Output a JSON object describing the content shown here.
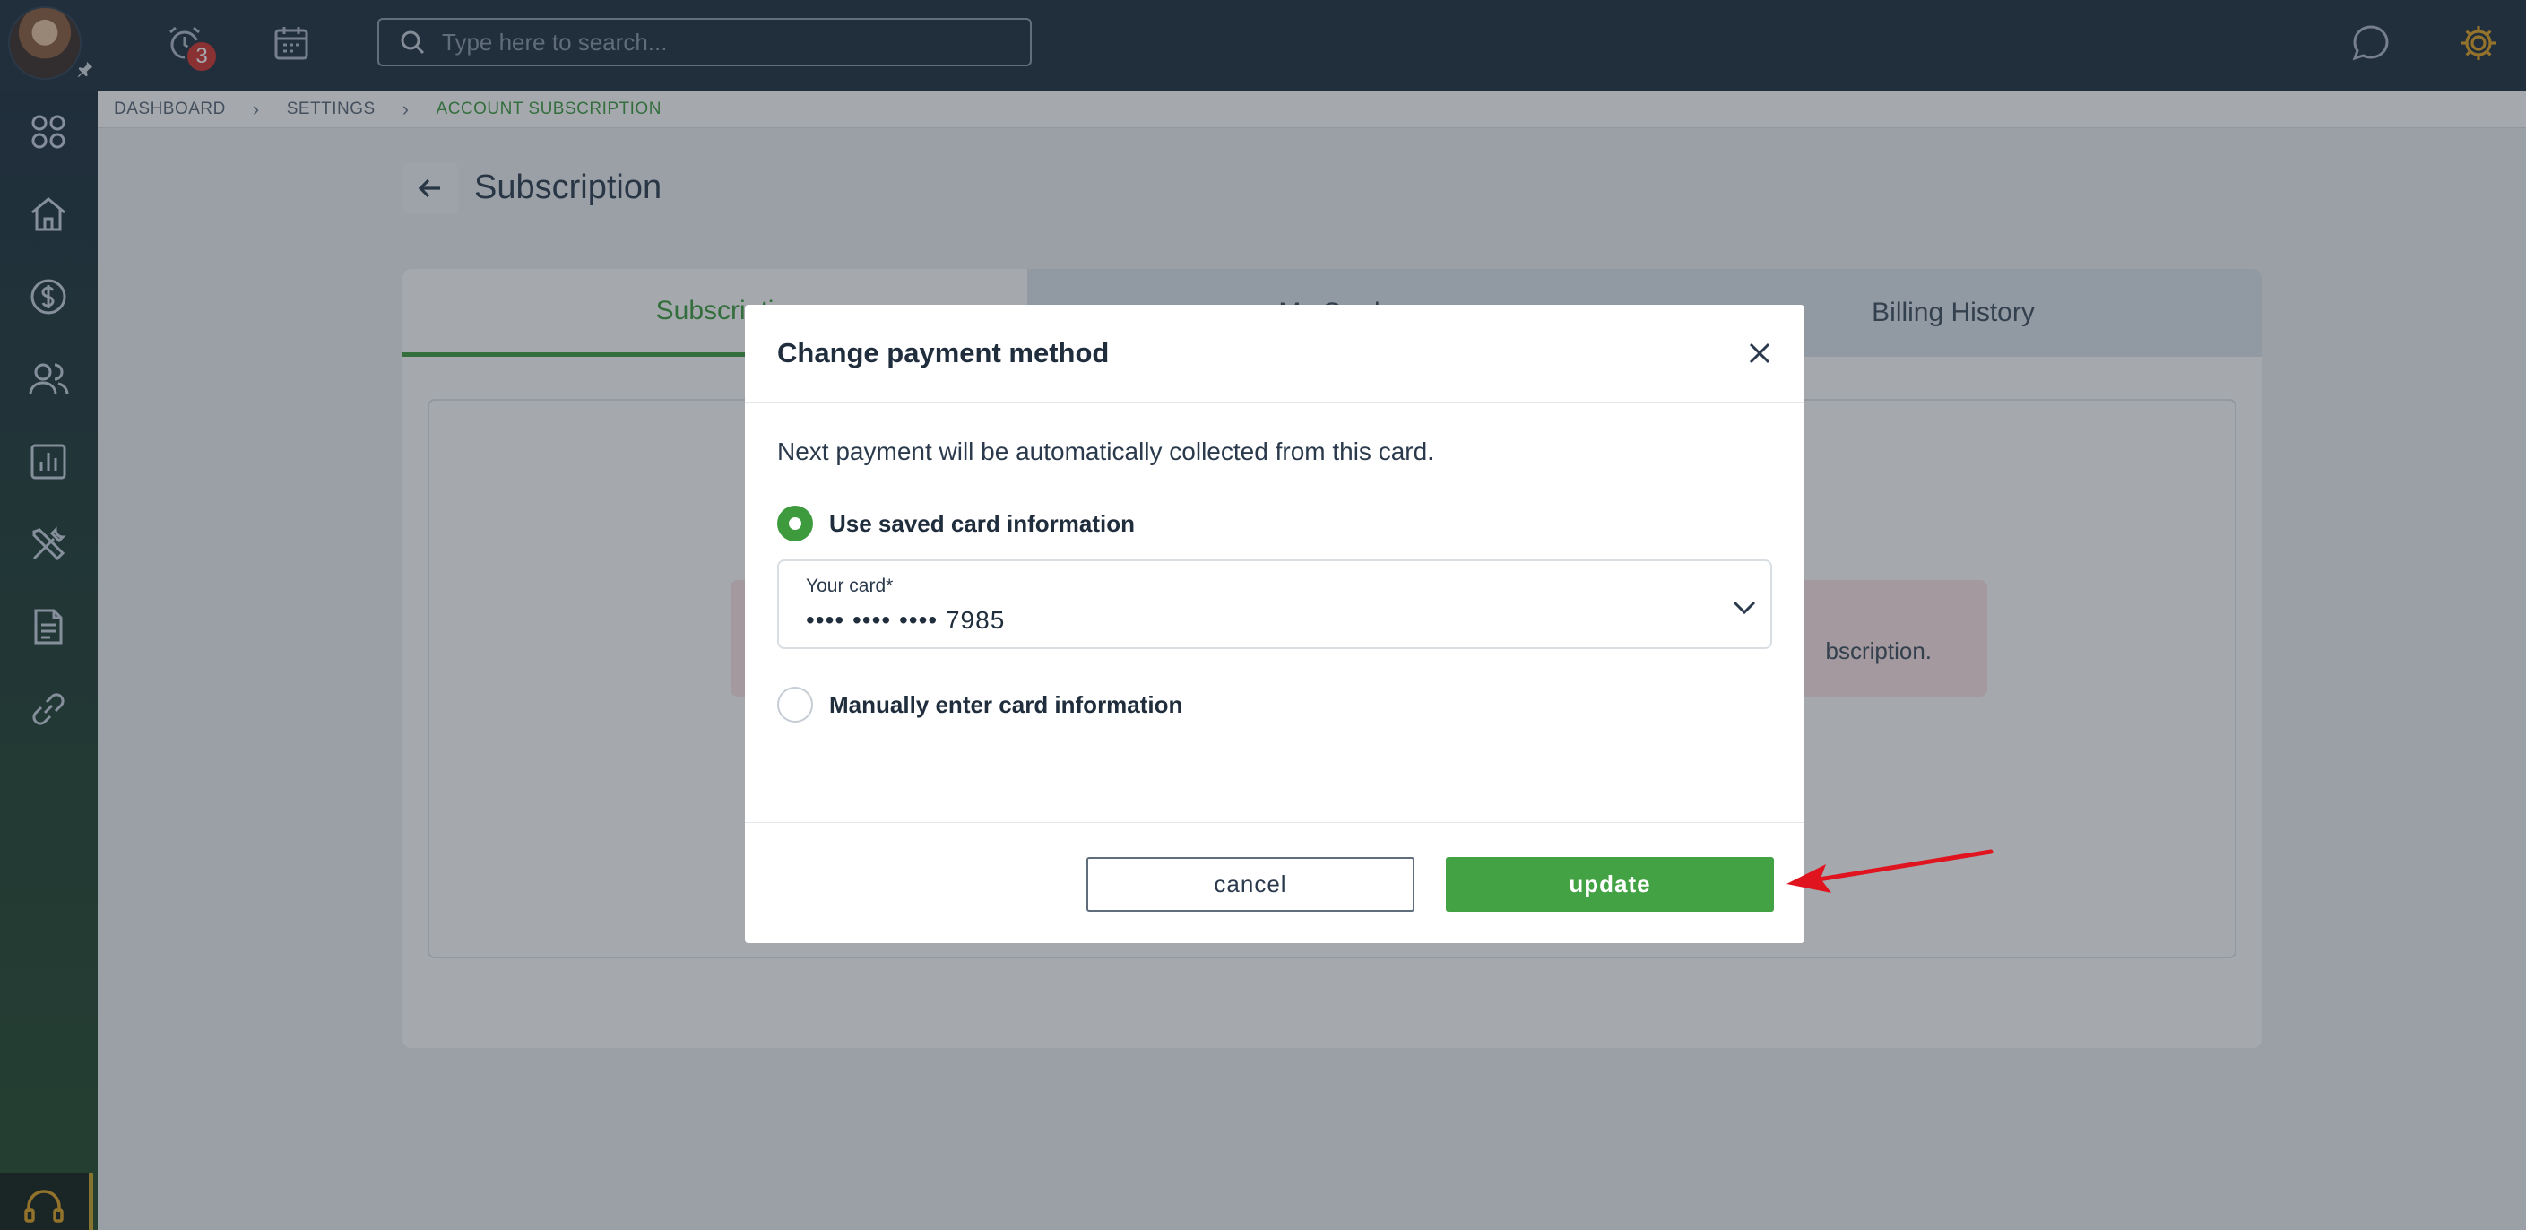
{
  "topbar": {
    "notification_count": "3",
    "search_placeholder": "Type here to search..."
  },
  "breadcrumb": {
    "items": [
      "DASHBOARD",
      "SETTINGS",
      "ACCOUNT SUBSCRIPTION"
    ]
  },
  "page": {
    "title": "Subscription",
    "tabs": [
      "Subscripti",
      "My Cards",
      "Billing History"
    ],
    "alert_text": "bscription."
  },
  "modal": {
    "title": "Change payment method",
    "description": "Next payment will be automatically collected from this card.",
    "option_saved": "Use saved card information",
    "card_label": "Your card*",
    "card_value": "•••• •••• •••• 7985",
    "option_manual": "Manually enter card information",
    "cancel_label": "cancel",
    "update_label": "update"
  },
  "colors": {
    "accent": "#43a344",
    "topbar": "#1d2b3a",
    "alert": "#c8161d",
    "annotation_arrow": "#e0141e"
  }
}
